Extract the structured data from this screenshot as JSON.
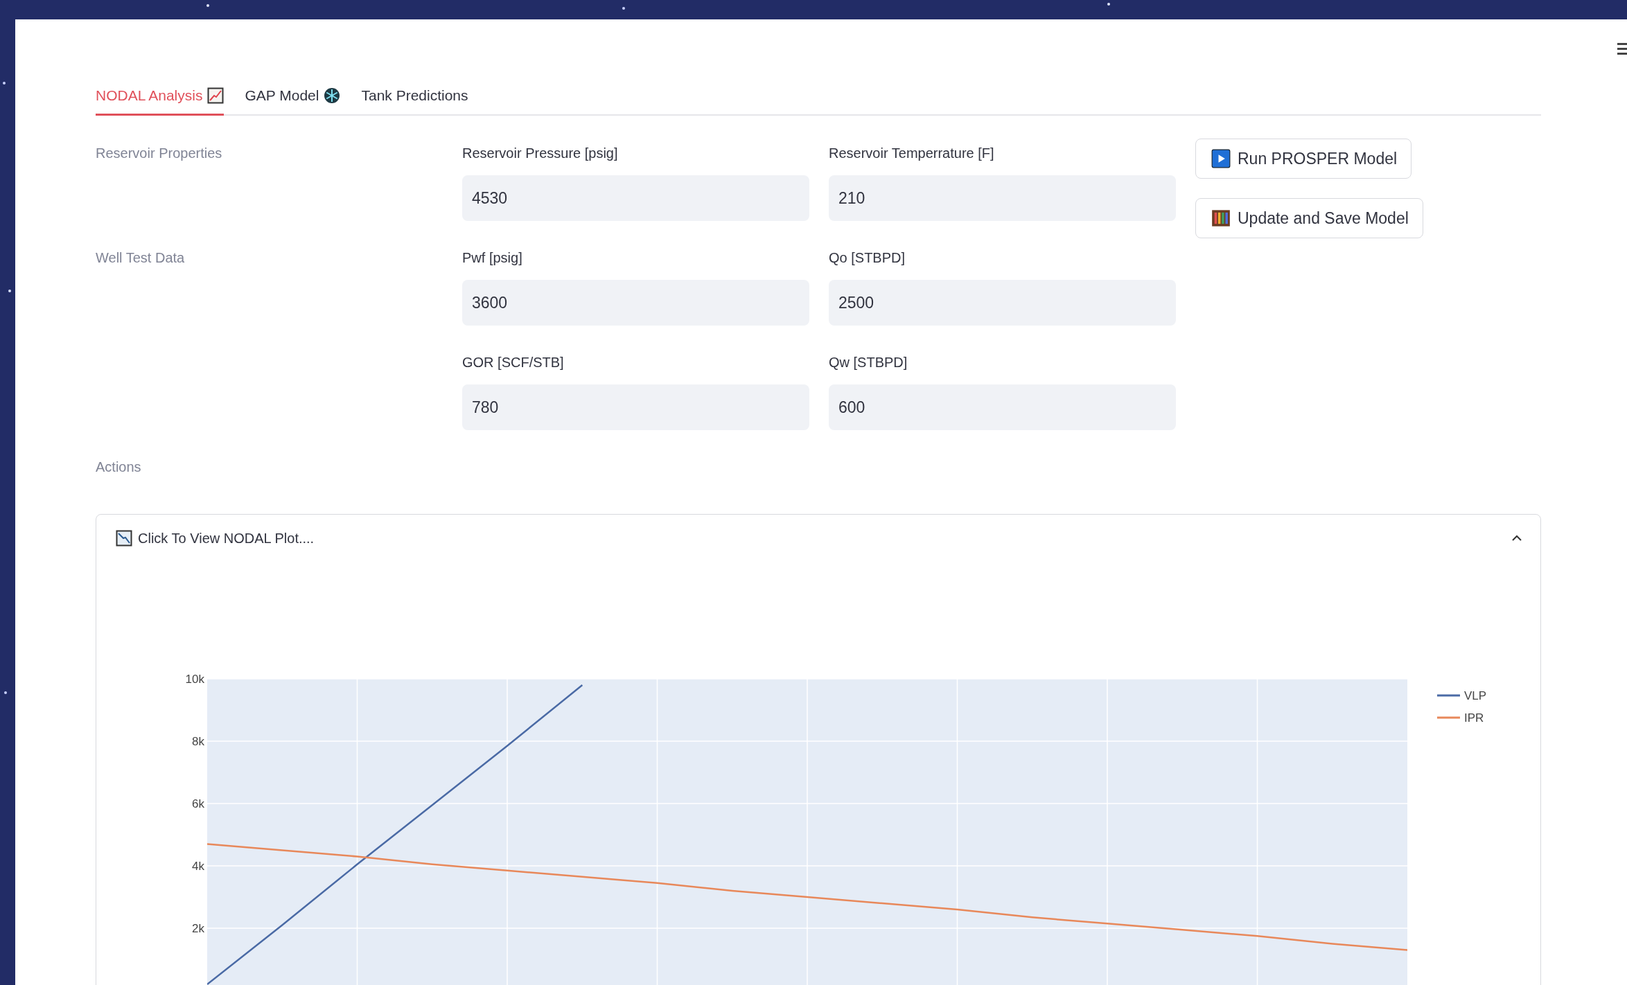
{
  "tabs": [
    {
      "label": "NODAL Analysis",
      "selected": true
    },
    {
      "label": "GAP Model",
      "selected": false
    },
    {
      "label": "Tank Predictions",
      "selected": false
    }
  ],
  "sections": [
    {
      "label": "Reservoir Properties",
      "fields": [
        {
          "label": "Reservoir Pressure [psig]",
          "value": "4530"
        },
        {
          "label": "Reservoir Temperrature [F]",
          "value": "210"
        }
      ]
    },
    {
      "label": "Well Test Data",
      "fields": [
        {
          "label": "Pwf [psig]",
          "value": "3600"
        },
        {
          "label": "Qo [STBPD]",
          "value": "2500"
        },
        {
          "label": "GOR [SCF/STB]",
          "value": "780"
        },
        {
          "label": "Qw [STBPD]",
          "value": "600"
        }
      ]
    }
  ],
  "buttons": [
    "Run PROSPER Model",
    "Update and Save Model"
  ],
  "actions_label": "Actions",
  "expander": {
    "title": "Click To View NODAL Plot....",
    "expanded": true,
    "chart_data": {
      "type": "line",
      "categories": [
        null,
        null,
        null,
        null,
        null,
        null,
        null,
        null,
        null,
        null,
        null,
        null,
        null,
        null,
        null,
        null,
        null
      ],
      "ylim": [
        0,
        10000
      ],
      "grid": true,
      "legend": true,
      "yticks": [
        {
          "value": 2000,
          "label": "2k"
        },
        {
          "value": 4000,
          "label": "4k"
        },
        {
          "value": 6000,
          "label": "6k"
        },
        {
          "value": 8000,
          "label": "8k"
        },
        {
          "value": 10000,
          "label": "10k"
        }
      ],
      "series": [
        {
          "name": "VLP",
          "color": "#4a6aa5",
          "values": [
            200,
            2100,
            4050,
            5950,
            7850,
            9800,
            null,
            null,
            null,
            null,
            null,
            null,
            null,
            null,
            null,
            null,
            null
          ]
        },
        {
          "name": "IPR",
          "color": "#e8885a",
          "values": [
            4700,
            4500,
            4300,
            4050,
            3850,
            3650,
            3450,
            3200,
            3000,
            2800,
            2600,
            2350,
            2150,
            1950,
            1750,
            1500,
            1300
          ]
        }
      ]
    }
  }
}
